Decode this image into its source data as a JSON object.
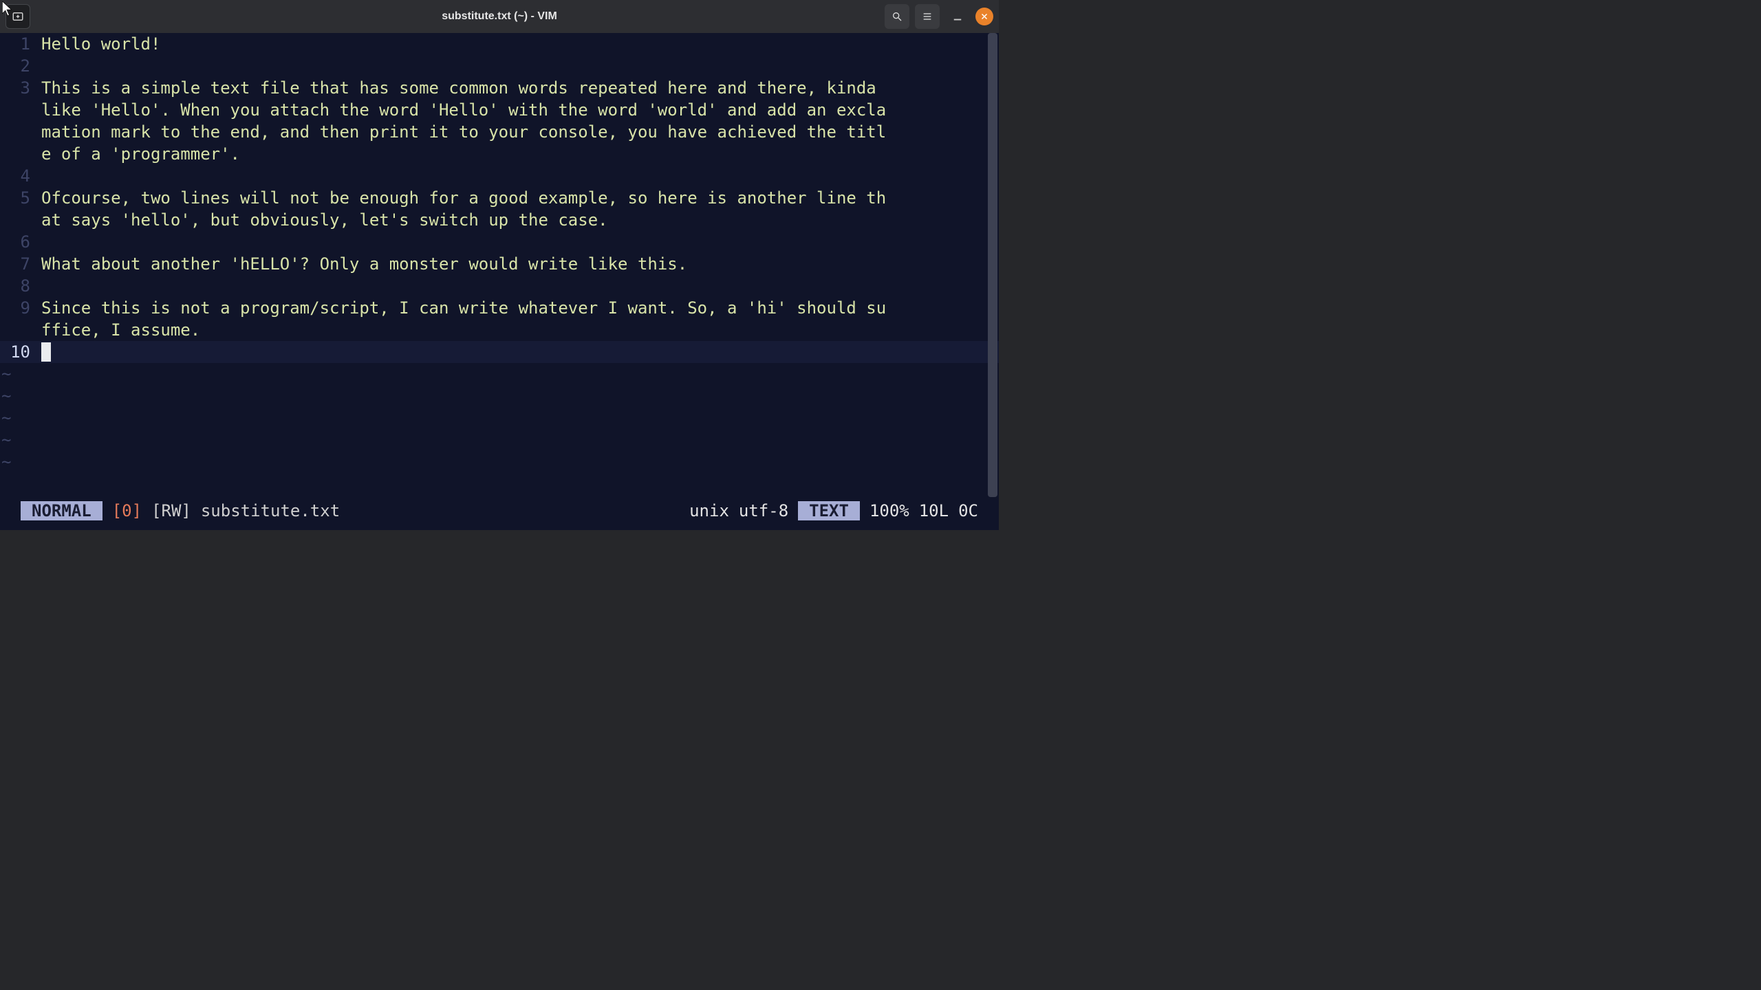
{
  "titlebar": {
    "title": "substitute.txt (~) - VIM"
  },
  "editor": {
    "lines": [
      {
        "num": "1",
        "text": "Hello world!"
      },
      {
        "num": "2",
        "text": ""
      },
      {
        "num": "3",
        "text": "This is a simple text file that has some common words repeated here and there, kinda like 'Hello'. When you attach the word 'Hello' with the word 'world' and add an exclamation mark to the end, and then print it to your console, you have achieved the title of a 'programmer'."
      },
      {
        "num": "4",
        "text": ""
      },
      {
        "num": "5",
        "text": "Ofcourse, two lines will not be enough for a good example, so here is another line that says 'hello', but obviously, let's switch up the case."
      },
      {
        "num": "6",
        "text": ""
      },
      {
        "num": "7",
        "text": "What about another 'hELLO'? Only a monster would write like this."
      },
      {
        "num": "8",
        "text": ""
      },
      {
        "num": "9",
        "text": "Since this is not a program/script, I can write whatever I want. So, a 'hi' should suffice, I assume."
      },
      {
        "num": "10",
        "text": "",
        "current": true,
        "cursor": true
      }
    ],
    "tilde": "~"
  },
  "status": {
    "mode": "NORMAL",
    "zero": "[0]",
    "rw": "[RW]",
    "file": "substitute.txt",
    "fileformat": "unix",
    "encoding": "utf-8",
    "syntax": "TEXT",
    "percent": "100%",
    "lines": "10L",
    "col": "0C"
  }
}
